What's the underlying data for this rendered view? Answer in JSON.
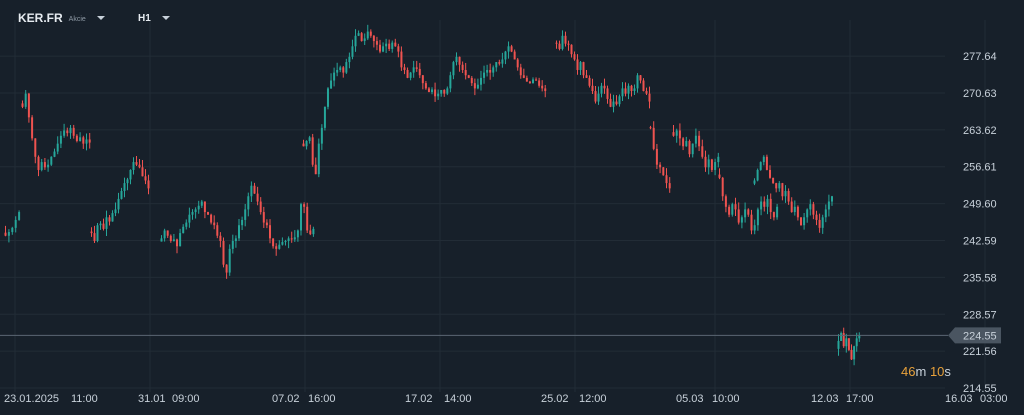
{
  "toolbar": {
    "symbol": "KER.FR",
    "instrument_type": "Akcie",
    "timeframe": "H1"
  },
  "countdown": {
    "minutes": "46",
    "min_unit": "m",
    "seconds": "10",
    "sec_unit": "s"
  },
  "colors": {
    "background": "#17202a",
    "up": "#26a69a",
    "down": "#ef5350",
    "grid": "#222c36",
    "price_line": "#5b6673",
    "price_label_bg": "#4a5561"
  },
  "chart_data": {
    "type": "candlestick",
    "symbol": "KER.FR",
    "timeframe": "H1",
    "y_ticks": [
      "277.64",
      "270.63",
      "263.62",
      "256.61",
      "249.60",
      "242.59",
      "235.58",
      "228.57",
      "221.56",
      "214.55"
    ],
    "ylim": [
      213.8,
      284.5
    ],
    "x_ticks": [
      "23.01.2025",
      "11:00",
      "31.01",
      "09:00",
      "07.02",
      "16:00",
      "17.02",
      "14:00",
      "25.02",
      "12:00",
      "05.03",
      "10:00",
      "12.03",
      "17:00",
      "16.03",
      "03:00"
    ],
    "current_price": "224.55",
    "closes": [
      [
        243.5,
        244.2,
        245.0,
        246.5,
        248.0
      ],
      [
        268.0,
        270.5,
        266.0,
        262.0,
        258.5,
        256.0,
        257.5,
        256.5,
        257.0,
        258.5,
        259.5,
        261.0,
        262.5,
        263.5,
        263.0,
        264.0,
        262.5,
        261.5,
        262.2,
        261.0,
        261.8,
        261.2
      ],
      [
        244.0,
        242.5,
        245.5,
        245.8,
        244.8,
        247.0,
        246.2,
        247.8,
        248.5,
        250.5,
        252.0,
        253.5,
        254.2,
        256.0,
        257.5,
        257.0,
        256.5,
        254.8,
        254.0,
        252.5
      ],
      [
        243.0,
        244.5,
        243.5,
        242.5,
        242.8,
        241.5,
        244.0,
        245.2,
        246.0,
        247.5,
        248.0,
        248.5,
        249.2,
        250.0,
        248.0,
        247.5,
        246.0,
        245.5,
        243.5,
        242.5,
        238.0,
        236.5,
        241.0,
        242.5,
        243.0,
        245.5,
        246.5,
        248.5,
        251.0,
        253.0,
        251.5,
        250.0,
        248.0,
        246.0,
        245.5,
        243.0,
        241.5,
        241.0,
        241.8,
        242.3,
        242.5,
        243.0,
        242.8,
        243.2,
        244.5,
        249.5,
        249.0,
        244.5,
        243.8,
        244.8
      ],
      [
        260.5,
        261.5,
        262.2,
        257.0,
        255.2,
        261.0,
        264.0,
        268.0,
        271.5,
        273.0,
        274.5,
        275.0,
        275.5,
        274.5,
        276.5,
        277.5,
        279.5,
        281.5,
        282.0,
        280.5,
        281.0,
        282.3,
        281.5,
        280.5,
        279.8,
        278.5,
        279.5,
        280.0,
        279.0,
        280.2,
        279.5,
        278.5,
        275.5,
        275.0,
        273.5,
        274.5,
        275.5,
        275.2,
        274.0,
        272.5,
        271.5,
        270.8,
        271.3,
        270.0,
        270.5,
        271.2,
        270.5,
        271.5,
        274.0,
        276.5,
        277.5,
        276.0,
        275.0,
        274.0,
        273.5,
        272.5,
        271.5,
        272.2,
        273.5,
        274.5,
        275.0,
        274.5,
        275.5,
        276.5,
        276.2,
        277.0,
        278.5,
        279.5,
        278.5,
        277.0,
        275.5,
        274.0,
        273.5,
        272.8,
        272.5,
        273.2,
        273.0,
        272.0,
        271.5,
        271.0
      ],
      [
        280.0,
        279.0,
        281.5,
        280.0,
        279.8,
        278.0,
        277.0,
        275.0,
        276.5,
        274.0,
        273.5,
        272.0,
        271.0,
        269.0,
        270.5,
        272.0,
        271.5,
        269.5,
        268.0,
        269.0,
        268.5,
        270.0,
        271.5,
        270.5,
        272.0,
        271.0,
        271.5,
        274.0,
        273.0,
        271.0,
        270.5,
        269.0
      ],
      [
        264.0,
        260.0,
        257.0,
        256.5,
        255.0,
        253.5,
        252.5
      ],
      [
        262.5,
        263.5,
        262.0,
        260.5,
        261.5,
        259.0,
        261.0,
        262.5,
        260.5,
        258.5,
        256.5,
        258.0,
        256.0,
        257.5,
        258.5
      ],
      [
        254.5,
        251.0,
        249.0,
        247.5,
        249.5,
        248.5,
        246.0,
        247.0,
        248.5,
        247.5,
        244.5,
        245.5,
        248.5,
        250.0,
        249.0,
        250.5,
        248.0,
        247.0,
        249.0
      ],
      [
        254.0,
        256.0,
        257.5,
        258.5,
        256.0,
        254.5,
        253.5,
        252.5,
        253.5,
        251.0,
        252.0,
        250.0,
        248.0,
        249.0,
        247.0,
        245.5,
        247.0,
        248.5,
        249.5,
        247.5,
        246.5,
        245.0,
        247.0,
        248.5,
        250.0,
        251.0
      ],
      [
        223.5,
        225.0,
        222.5,
        224.0,
        221.8,
        220.0,
        222.5,
        224.0,
        224.55
      ]
    ]
  }
}
